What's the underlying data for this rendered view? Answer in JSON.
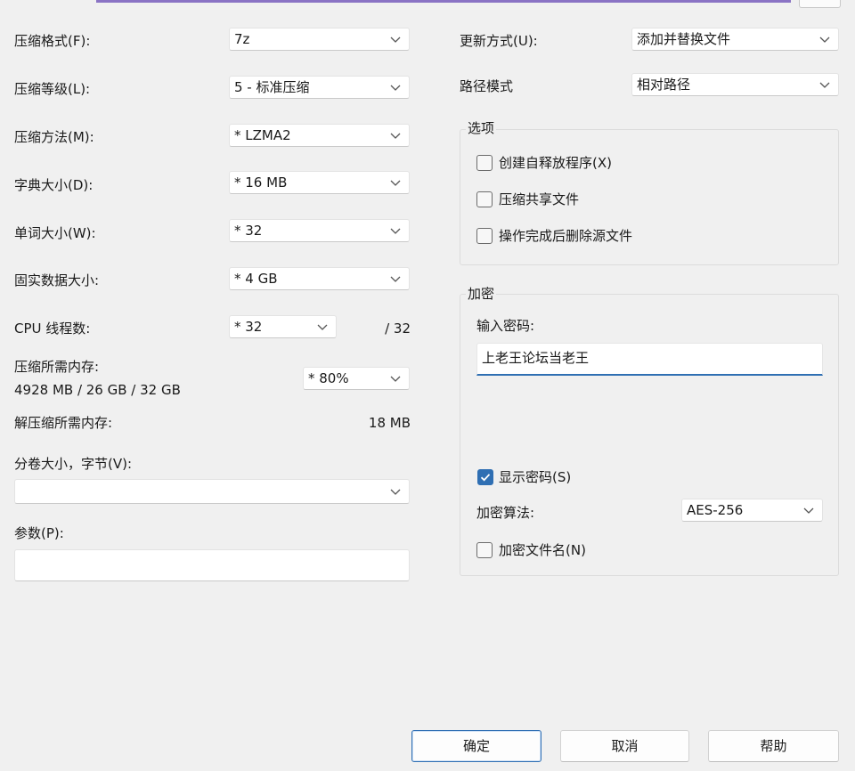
{
  "left": {
    "format": {
      "label": "压缩格式(F):",
      "value": "7z"
    },
    "level": {
      "label": "压缩等级(L):",
      "value": "5 - 标准压缩"
    },
    "method": {
      "label": "压缩方法(M):",
      "value": "*  LZMA2"
    },
    "dict": {
      "label": "字典大小(D):",
      "value": "*  16 MB"
    },
    "word": {
      "label": "单词大小(W):",
      "value": "*  32"
    },
    "solid": {
      "label": "固实数据大小:",
      "value": "*  4 GB"
    },
    "threads": {
      "label": "CPU 线程数:",
      "value": "*  32",
      "max": "/ 32"
    },
    "mem": {
      "label": "压缩所需内存:",
      "detail": "4928 MB / 26 GB / 32 GB",
      "value": "* 80%"
    },
    "decomp": {
      "label": "解压缩所需内存:",
      "value": "18 MB"
    },
    "split": {
      "label": "分卷大小，字节(V):",
      "value": ""
    },
    "params": {
      "label": "参数(P):",
      "value": ""
    }
  },
  "right": {
    "update": {
      "label": "更新方式(U):",
      "value": "添加并替换文件"
    },
    "path": {
      "label": "路径模式",
      "value": "相对路径"
    },
    "options": {
      "title": "选项",
      "sfx": {
        "label": "创建自释放程序(X)",
        "checked": false
      },
      "shared": {
        "label": "压缩共享文件",
        "checked": false
      },
      "delete": {
        "label": "操作完成后删除源文件",
        "checked": false
      }
    },
    "encryption": {
      "title": "加密",
      "pw_label": "输入密码:",
      "password": "上老王论坛当老王",
      "show": {
        "label": "显示密码(S)",
        "checked": true
      },
      "algo_label": "加密算法:",
      "algo": "AES-256",
      "names": {
        "label": "加密文件名(N)",
        "checked": false
      }
    }
  },
  "buttons": {
    "ok": "确定",
    "cancel": "取消",
    "help": "帮助"
  },
  "colors": {
    "accent": "#2f6fb3",
    "background": "#f0f0f0"
  }
}
